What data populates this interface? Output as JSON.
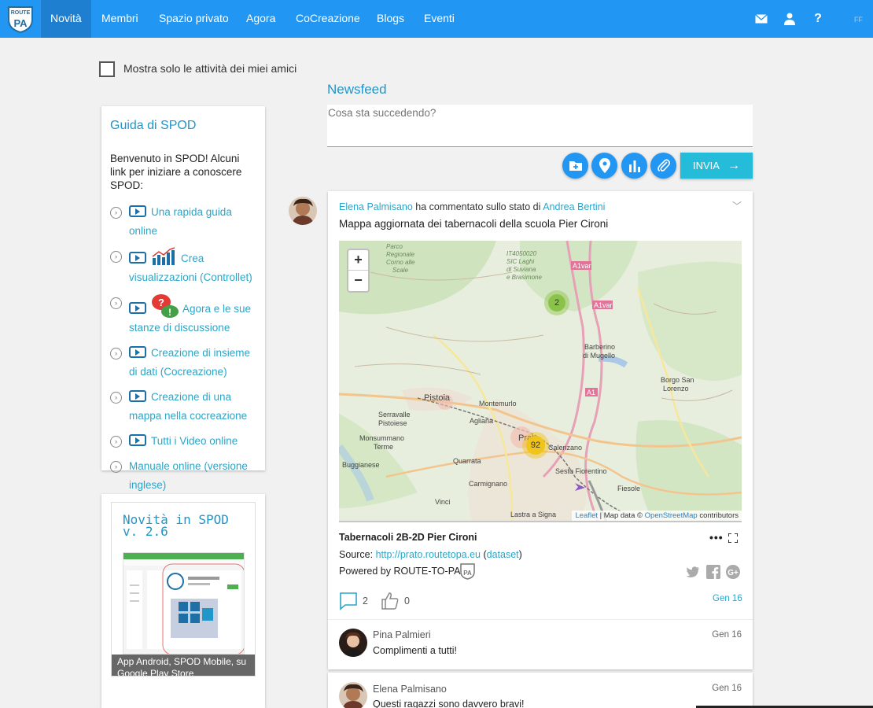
{
  "nav": {
    "logo_text": "ROUTE TO PA",
    "items": [
      "Novità",
      "Membri",
      "Spazio privato",
      "Agora",
      "CoCreazione",
      "Blogs",
      "Eventi"
    ],
    "icons": [
      "mail-icon",
      "user-icon",
      "help-icon"
    ],
    "help_label": "?",
    "corner_text": "FF"
  },
  "filter": {
    "label": "Mostra solo le attività dei miei amici",
    "checked": false
  },
  "guide": {
    "title": "Guida di SPOD",
    "intro": "Benvenuto in SPOD! Alcuni link per iniziare a conoscere SPOD:",
    "items": [
      "Una rapida guida online",
      "Crea visualizzazioni (Controllet)",
      "Agora e le sue stanze di discussione",
      "Creazione di insieme di dati (Cocreazione)",
      "Creazione di una mappa nella cocreazione",
      "Tutti i Video online",
      "Manuale online (versione inglese)"
    ]
  },
  "news": {
    "title": "Novità in SPOD v. 2.6",
    "caption": "App Android, SPOD Mobile, su Google Play Store"
  },
  "feed": {
    "title": "Newsfeed",
    "placeholder": "Cosa sta succedendo?",
    "send_label": "INVIA",
    "action_icons": [
      "add-folder-icon",
      "location-pin-icon",
      "bar-chart-icon",
      "paperclip-icon"
    ]
  },
  "post": {
    "author": "Elena Palmisano",
    "action": "ha commentato sullo stato di",
    "target": "Andrea Bertini",
    "text": "Mappa aggiornata dei tabernacoli della scuola Pier Cironi",
    "map": {
      "zoom_in": "+",
      "zoom_out": "−",
      "attribution_leaflet": "Leaflet",
      "attribution_sep": " | Map data ©",
      "attribution_osm": "OpenStreetMap",
      "attribution_tail": "contributors",
      "clusters": [
        {
          "count": "2",
          "color": "#8bc34a"
        },
        {
          "count": "92",
          "color": "#f0c419"
        }
      ],
      "place_labels": [
        "Pistoia",
        "Prato",
        "Montemurlo",
        "Agliana",
        "Calenzano",
        "Sesto Fiorentino",
        "Quarrata",
        "Carmignano",
        "Serravalle Pistoiese",
        "Monsummano Terme",
        "Buggianese",
        "Vinci",
        "Lastra a Signa",
        "Fiesole",
        "Barberino di Mugello",
        "Borgo San Lorenzo",
        "A1var",
        "A1",
        "IT4050020 SIC Laghi di Suviana e Brasimone",
        "Parco Regionale Corno alle Scale"
      ]
    },
    "dataset_title": "Tabernacoli 2B-2D Pier Cironi",
    "more_label": "•••",
    "source_label": "Source:",
    "source_url": "http://prato.routetopa.eu",
    "dataset_link": "dataset",
    "powered_label": "Powered by ROUTE-TO-PA",
    "comments_count": "2",
    "likes_count": "0",
    "date": "Gen 16",
    "share_icons": [
      "twitter-icon",
      "facebook-icon",
      "google-plus-icon"
    ],
    "comment": {
      "author": "Pina Palmieri",
      "text": "Complimenti a tutti!",
      "date": "Gen 16"
    }
  },
  "post2": {
    "author": "Elena Palmisano",
    "text": "Questi ragazzi sono davvero bravi!",
    "date": "Gen 16"
  }
}
